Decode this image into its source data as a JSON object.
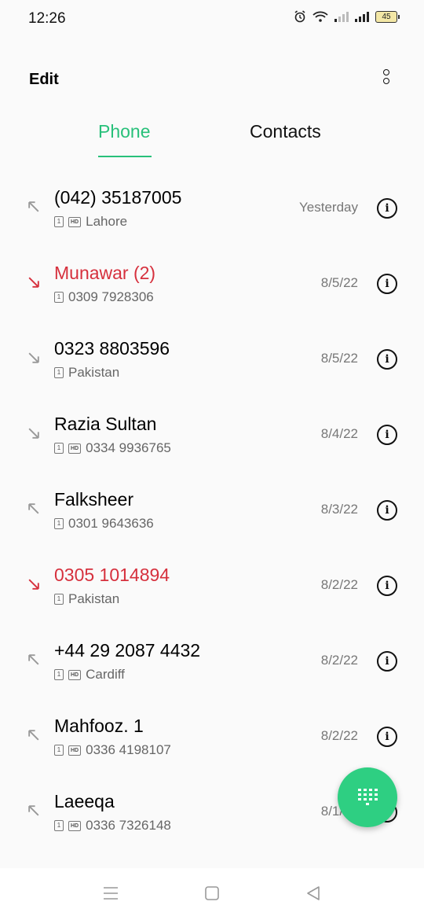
{
  "status": {
    "time": "12:26",
    "battery": "45"
  },
  "header": {
    "edit_label": "Edit"
  },
  "tabs": [
    {
      "label": "Phone"
    },
    {
      "label": "Contacts"
    }
  ],
  "calls": [
    {
      "name": "(042) 35187005",
      "detail": "Lahore",
      "date": "Yesterday",
      "type": "outgoing",
      "hd": true
    },
    {
      "name": "Munawar (2)",
      "detail": "0309 7928306",
      "date": "8/5/22",
      "type": "missed",
      "hd": false
    },
    {
      "name": "0323 8803596",
      "detail": "Pakistan",
      "date": "8/5/22",
      "type": "incoming",
      "hd": false
    },
    {
      "name": "Razia Sultan",
      "detail": "0334 9936765",
      "date": "8/4/22",
      "type": "incoming",
      "hd": true
    },
    {
      "name": "Falksheer",
      "detail": "0301 9643636",
      "date": "8/3/22",
      "type": "outgoing",
      "hd": false
    },
    {
      "name": "0305 1014894",
      "detail": "Pakistan",
      "date": "8/2/22",
      "type": "missed",
      "hd": false
    },
    {
      "name": "+44 29 2087 4432",
      "detail": "Cardiff",
      "date": "8/2/22",
      "type": "outgoing",
      "hd": true
    },
    {
      "name": "Mahfooz. 1",
      "detail": "0336 4198107",
      "date": "8/2/22",
      "type": "outgoing",
      "hd": true
    },
    {
      "name": "Laeeqa",
      "detail": "0336 7326148",
      "date": "8/1/22",
      "type": "outgoing",
      "hd": true
    }
  ],
  "badges": {
    "sim": "1",
    "hd": "HD"
  },
  "icons": {
    "info": "i",
    "fab": "dialpad-icon"
  },
  "colors": {
    "accent": "#28c07a",
    "missed": "#d6303d",
    "fab": "#2ecf82"
  }
}
